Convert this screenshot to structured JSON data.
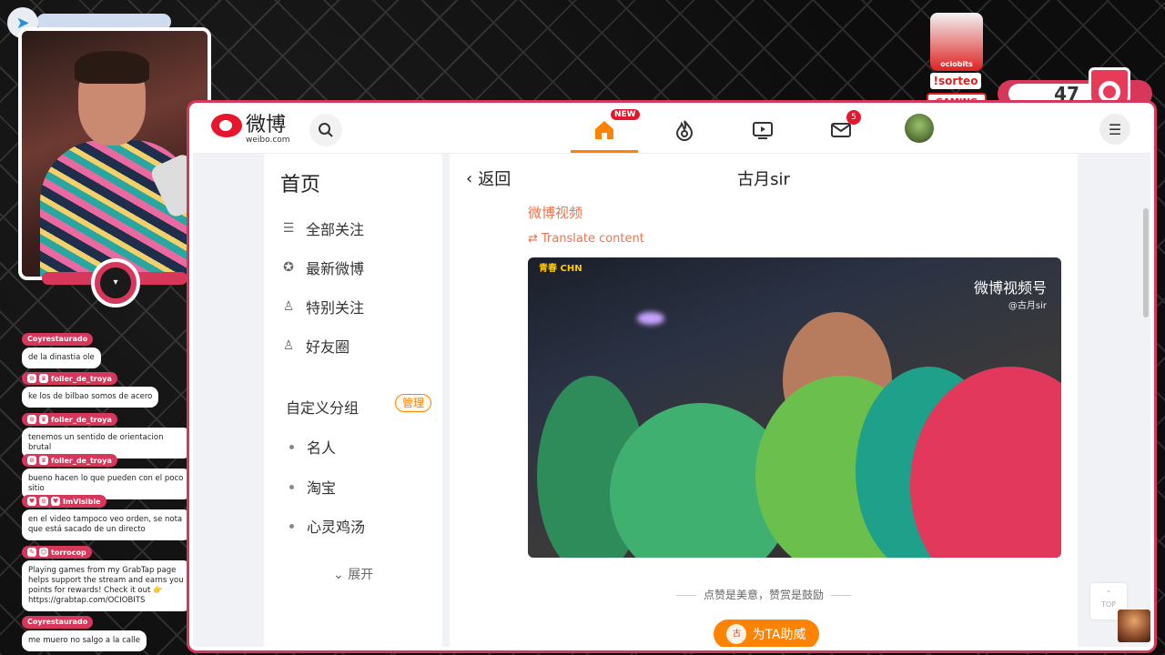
{
  "stream": {
    "score": "47",
    "sorteo_label": "!sorteo",
    "sorteo_brand": "ociobits",
    "gaming_label": "GAMING"
  },
  "chat": [
    {
      "user": "Coyrestaurado",
      "text": "de la dinastia ole"
    },
    {
      "user": "foller_de_troya",
      "text": "ke los de bilbao somos de acero"
    },
    {
      "user": "foller_de_troya",
      "text": "tenemos un sentido de orientacion brutal"
    },
    {
      "user": "foller_de_troya",
      "text": "bueno hacen lo que pueden con el poco sitio"
    },
    {
      "user": "ImVisible",
      "text": "en el video tampoco veo orden, se nota que está sacado de un directo"
    },
    {
      "user": "torrocop",
      "text": "Playing games from my GrabTap page helps support the stream and earns you points for rewards! Check it out 👉 https://grabtap.com/OCIOBITS"
    },
    {
      "user": "Coyrestaurado",
      "text": "me muero no salgo a la calle"
    }
  ],
  "weibo": {
    "logo_text": "微博",
    "logo_domain": "weibo.com",
    "nav": {
      "new_badge": "NEW",
      "message_count": "5"
    },
    "sidebar": {
      "title": "首页",
      "items": [
        "全部关注",
        "最新微博",
        "特别关注",
        "好友圈"
      ],
      "group_title": "自定义分组",
      "manage_label": "管理",
      "groups": [
        "名人",
        "淘宝",
        "心灵鸡汤"
      ],
      "more_label": "展开"
    },
    "main": {
      "back_label": "返回",
      "page_title": "古月sir",
      "source_link": "微博视频",
      "translate_label": "Translate content",
      "video_watermark": "微博视频号",
      "video_watermark_sub": "@古月sir",
      "video_logo": "青春 CHN",
      "like_text": "点赞是美意，赞赏是鼓励",
      "support_label": "为TA助威",
      "support_avatar_text": "古",
      "top_label": "TOP"
    }
  }
}
